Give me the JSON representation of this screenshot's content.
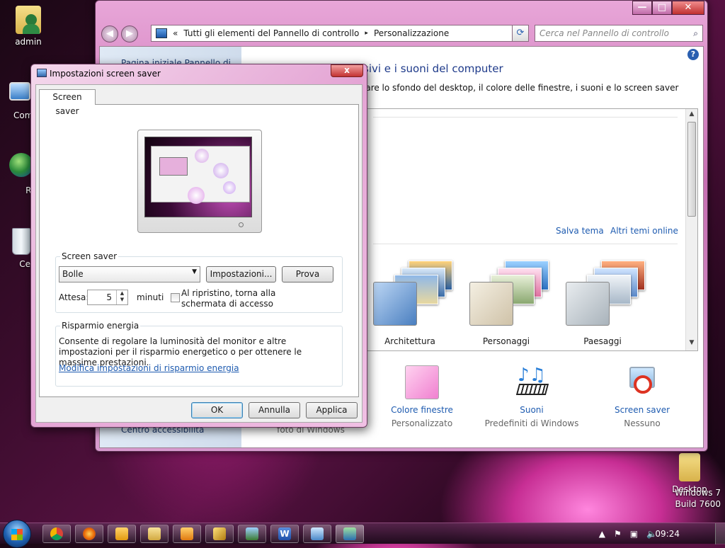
{
  "desktop": {
    "icons": [
      {
        "label": "admin",
        "icon": "user-folder-icon"
      },
      {
        "label": "Comp",
        "icon": "computer-icon"
      },
      {
        "label": "Ret",
        "icon": "network-icon"
      },
      {
        "label": "Cest",
        "icon": "recycle-bin-icon"
      }
    ],
    "right_folder_label": "Desktop",
    "watermark": [
      "Windows 7",
      "Build 7600"
    ]
  },
  "control_panel": {
    "breadcrumb_prefix": "«",
    "breadcrumb_1": "Tutti gli elementi del Pannello di controllo",
    "breadcrumb_sep": "▸",
    "breadcrumb_2": "Personalizzazione",
    "search_placeholder": "Cerca nel Pannello di controllo",
    "sidebar_top": "Pagina iniziale Pannello di",
    "sidebar_bottom": "Centro accessibilità",
    "heading": "sivi e i suoni del computer",
    "subtext": "iare lo sfondo del desktop, il colore delle finestre, i suoni e lo screen saver",
    "theme_links": {
      "save": "Salva tema",
      "more": "Altri temi online"
    },
    "themes": [
      {
        "name": "Architettura"
      },
      {
        "name": "Personaggi"
      },
      {
        "name": "Paesaggi"
      }
    ],
    "bottom_items": [
      {
        "label": "",
        "sub": "foto di Windows"
      },
      {
        "label": "Colore finestre",
        "sub": "Personalizzato",
        "icon": "window-color-icon"
      },
      {
        "label": "Suoni",
        "sub": "Predefiniti di Windows",
        "icon": "sounds-icon"
      },
      {
        "label": "Screen saver",
        "sub": "Nessuno",
        "icon": "screensaver-icon"
      }
    ]
  },
  "dialog": {
    "title": "Impostazioni screen saver",
    "close": "x",
    "tab": "Screen saver",
    "screensaver_group": "Screen saver",
    "selected": "Bolle",
    "settings_button": "Impostazioni...",
    "preview_button": "Prova",
    "wait_label": "Attesa:",
    "wait_value": "5",
    "minutes": "minuti",
    "resume_checkbox": "Al ripristino, torna alla schermata di accesso",
    "resume_checked": false,
    "energy_group": "Risparmio energia",
    "energy_text": "Consente di regolare la luminosità del monitor e altre impostazioni per il risparmio energetico o per ottenere le massime prestazioni.",
    "energy_link": "Modifica impostazioni di risparmio energia",
    "ok": "OK",
    "cancel": "Annulla",
    "apply": "Applica"
  },
  "taskbar": {
    "buttons": [
      "chrome-icon",
      "firefox-icon",
      "outlook-icon",
      "explorer-icon",
      "media-player-icon",
      "tools-icon",
      "network-map-icon",
      "word-icon",
      "remote-desktop-icon",
      "control-panel-icon"
    ],
    "clock": "09:24"
  },
  "colors": {
    "accent": "#1e5bb0",
    "window_frame": "#c76fb2"
  }
}
